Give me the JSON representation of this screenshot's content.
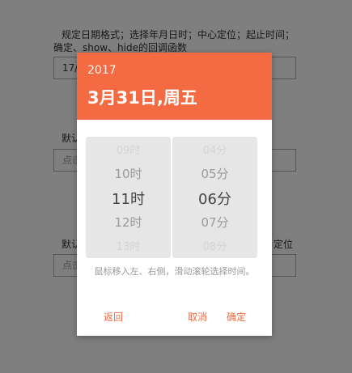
{
  "background": {
    "description_line1": "规定日期格式；选择年月日时；中心定位；起止时间；",
    "description_line2": "确定、show、hide的回调函数",
    "input1_value": "17/",
    "label2": "默认",
    "input2_placeholder": "点击",
    "label3": "默认",
    "label3_suffix": "定位",
    "input3_placeholder": "点击"
  },
  "picker": {
    "year": "2017",
    "date": "3月31日,周五",
    "hours": [
      "09时",
      "10时",
      "11时",
      "12时",
      "13时"
    ],
    "minutes": [
      "04分",
      "05分",
      "06分",
      "07分",
      "08分"
    ],
    "hint": "鼠标移入左、右侧，滑动滚轮选择时间。",
    "back_label": "返回",
    "cancel_label": "取消",
    "ok_label": "确定"
  },
  "colors": {
    "accent": "#f46a42",
    "overlay": "rgba(0,0,0,0.5)"
  }
}
